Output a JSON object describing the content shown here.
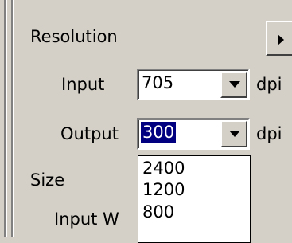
{
  "resolution": {
    "heading": "Resolution",
    "input": {
      "label": "Input",
      "value": "705",
      "unit": "dpi"
    },
    "output": {
      "label": "Output",
      "value": "300",
      "unit": "dpi",
      "options": [
        "2400",
        "1200",
        "800"
      ]
    }
  },
  "size": {
    "heading": "Size",
    "input_width_label": "Input W"
  },
  "colors": {
    "face": "#d4d0c8",
    "selection": "#000080",
    "field": "#ffffff"
  }
}
